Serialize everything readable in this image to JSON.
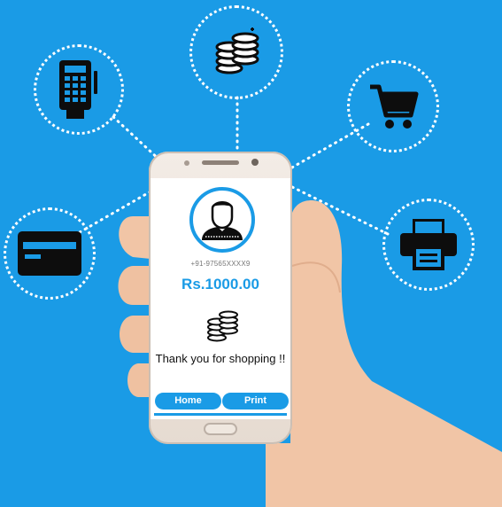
{
  "icons": {
    "payment_terminal": "card-terminal-icon",
    "coins": "coins-stack-icon",
    "cart": "shopping-cart-icon",
    "credit_card": "credit-card-icon",
    "printer": "printer-icon"
  },
  "screen": {
    "phone_number": "+91-97565XXXX9",
    "amount": "Rs.1000.00",
    "message": "Thank you for shopping !!",
    "buttons": {
      "home": "Home",
      "print": "Print"
    }
  },
  "colors": {
    "background": "#1a9be6",
    "accent": "#1a9be6",
    "icon": "#0d0d0d",
    "dots": "#ffffff"
  }
}
